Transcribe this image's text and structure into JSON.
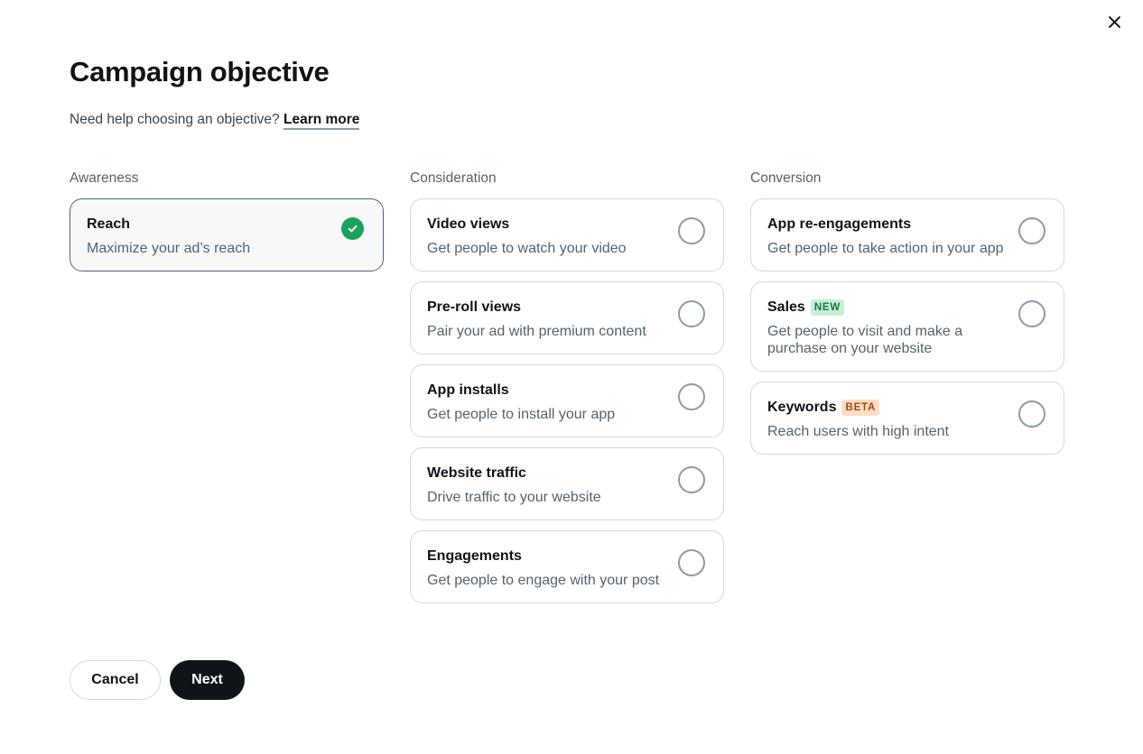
{
  "dialog": {
    "title": "Campaign objective",
    "help_text": "Need help choosing an objective?",
    "help_link": "Learn more",
    "close_icon": "close-icon"
  },
  "columns": [
    {
      "label": "Awareness",
      "options": [
        {
          "title": "Reach",
          "description": "Maximize your ad’s reach",
          "selected": true
        }
      ]
    },
    {
      "label": "Consideration",
      "options": [
        {
          "title": "Video views",
          "description": "Get people to watch your video",
          "selected": false
        },
        {
          "title": "Pre-roll views",
          "description": "Pair your ad with premium content",
          "selected": false
        },
        {
          "title": "App installs",
          "description": "Get people to install your app",
          "selected": false
        },
        {
          "title": "Website traffic",
          "description": "Drive traffic to your website",
          "selected": false
        },
        {
          "title": "Engagements",
          "description": "Get people to engage with your post",
          "selected": false
        }
      ]
    },
    {
      "label": "Conversion",
      "options": [
        {
          "title": "App re-engagements",
          "description": "Get people to take action in your app",
          "selected": false
        },
        {
          "title": "Sales",
          "badge": "NEW",
          "description": "Get people to visit and make a purchase on your website",
          "selected": false
        },
        {
          "title": "Keywords",
          "badge": "BETA",
          "description": "Reach users with high intent",
          "selected": false
        }
      ]
    }
  ],
  "footer": {
    "cancel_label": "Cancel",
    "next_label": "Next"
  },
  "colors": {
    "selected_check": "#17a35b",
    "primary_button": "#0f1419",
    "new_badge_bg": "#c7f0d6",
    "beta_badge_bg": "#ffdcc2"
  }
}
